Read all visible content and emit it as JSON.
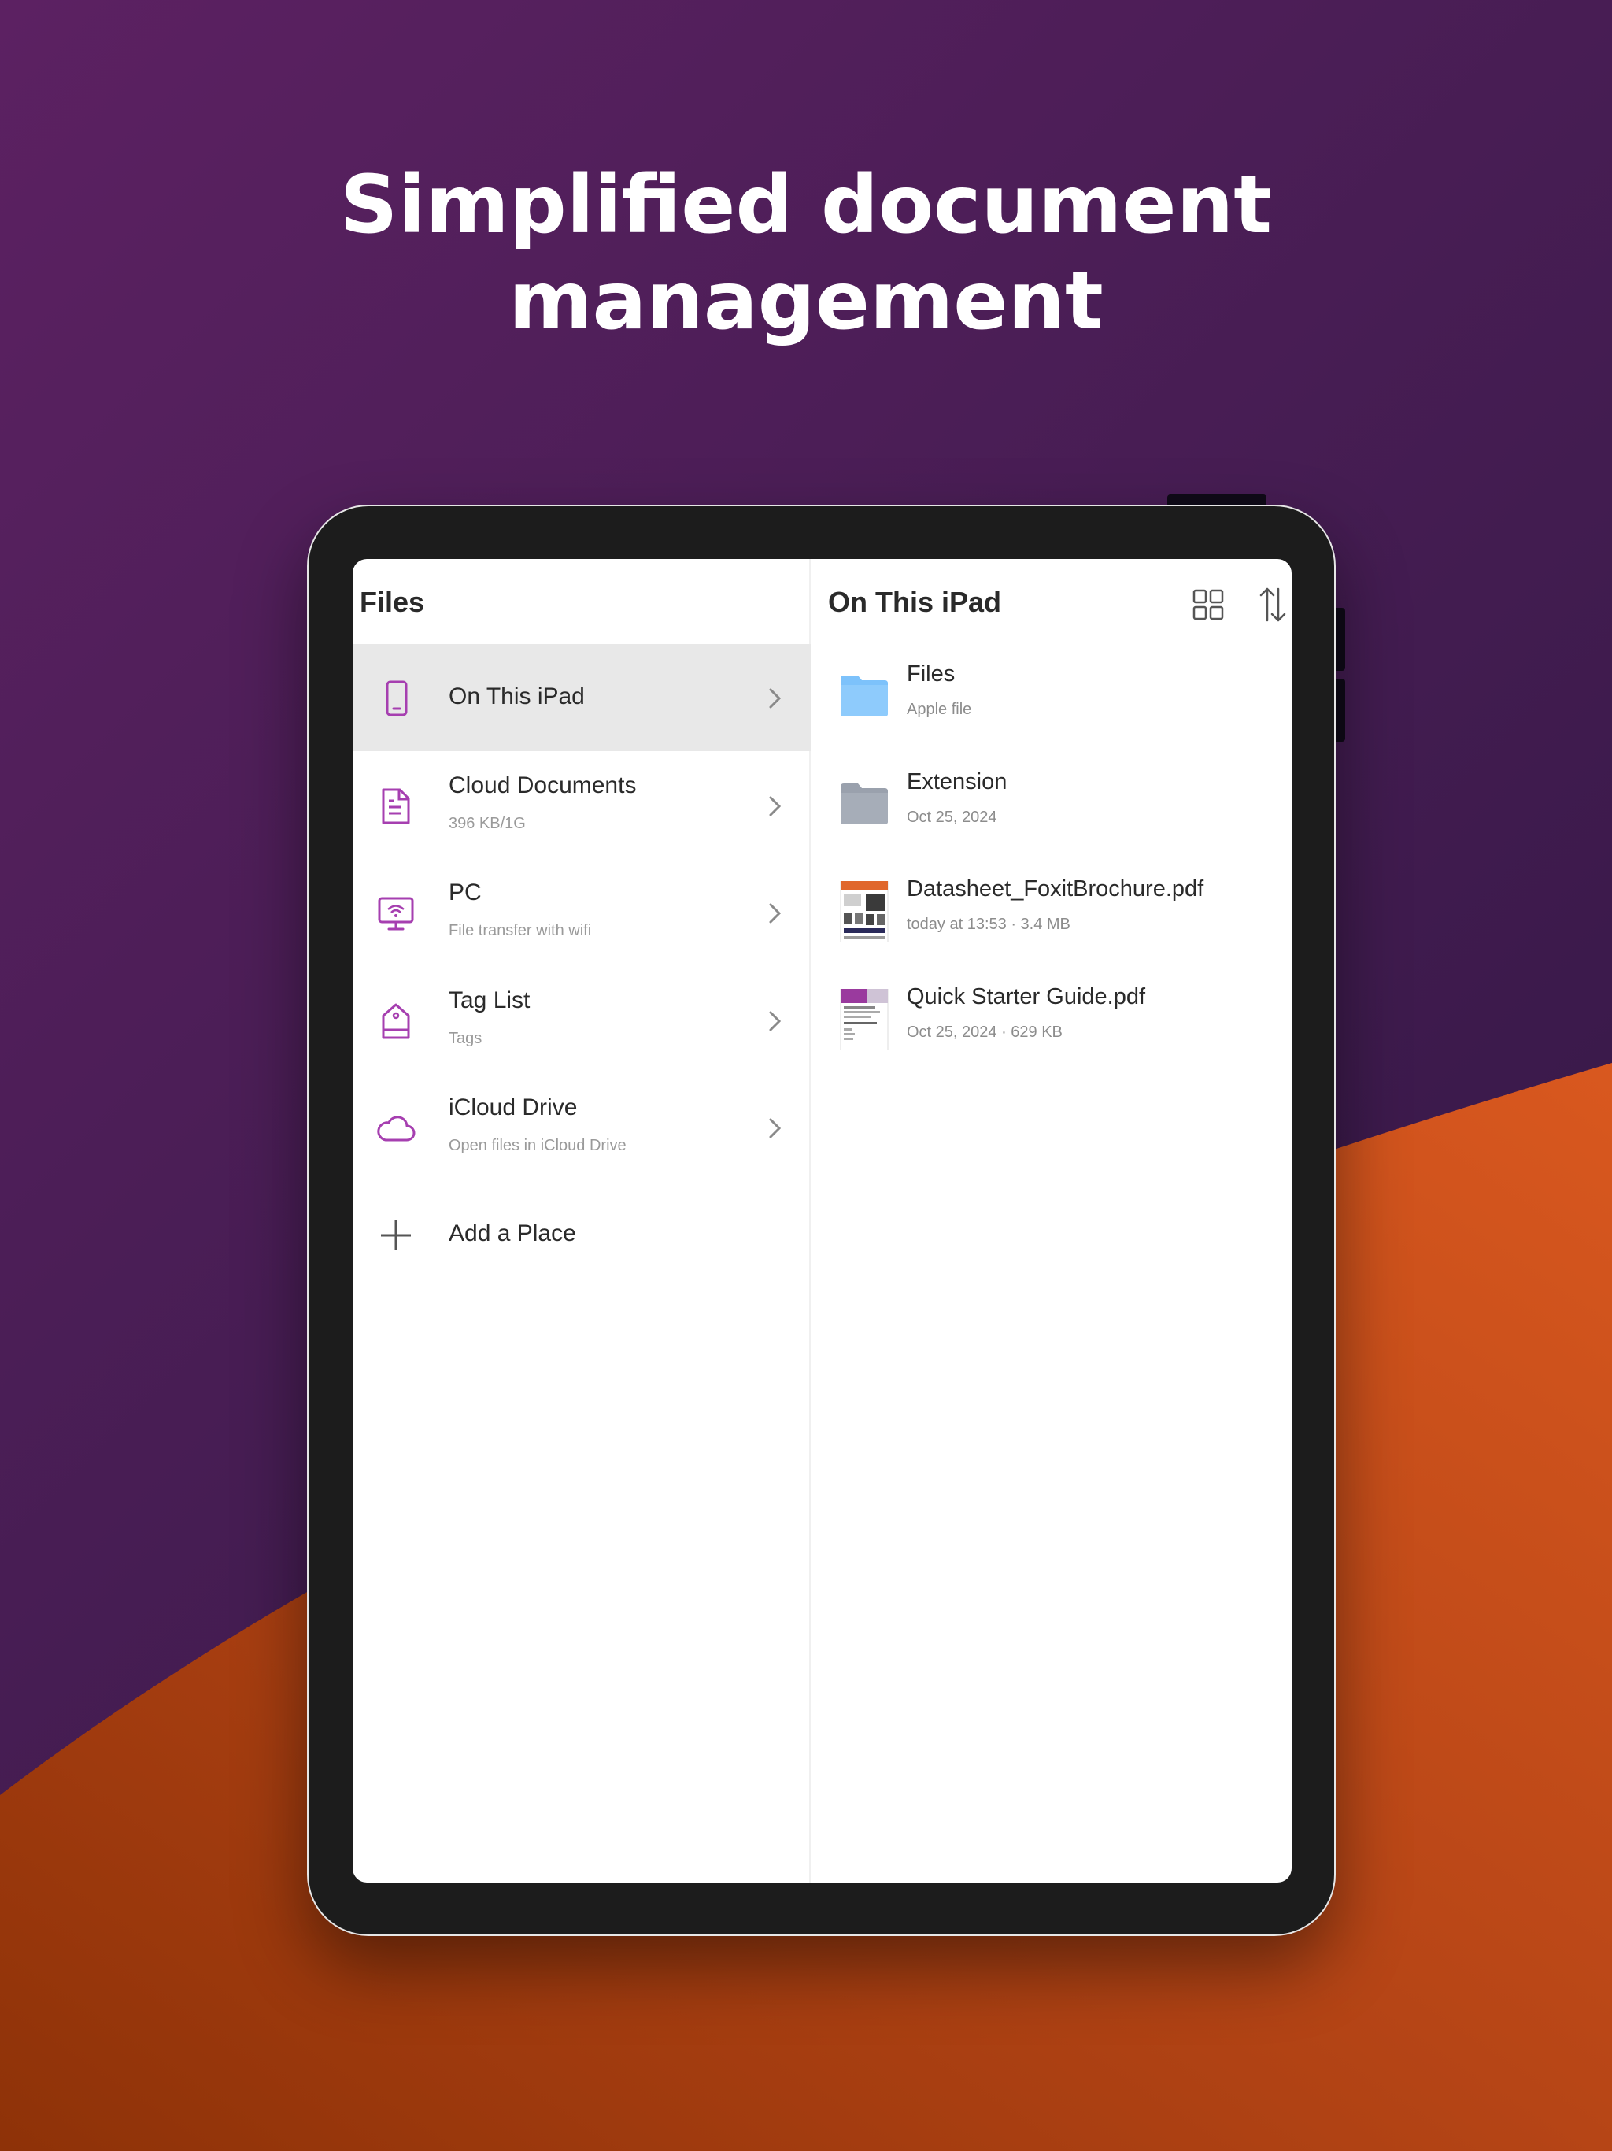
{
  "headline": {
    "line1": "Simplified document",
    "line2": "management"
  },
  "colors": {
    "accent": "#a63fb0",
    "folder_blue": "#7dc2fb",
    "folder_gray": "#a6adb8",
    "orange": "#c9511c"
  },
  "sidebar": {
    "title": "Files",
    "items": [
      {
        "label": "On This iPad",
        "sub": "",
        "icon": "ipad-icon",
        "active": true
      },
      {
        "label": "Cloud Documents",
        "sub": "396 KB/1G",
        "icon": "document-icon"
      },
      {
        "label": "PC",
        "sub": "File transfer with wifi",
        "icon": "monitor-wifi-icon"
      },
      {
        "label": "Tag List",
        "sub": "Tags",
        "icon": "tag-icon"
      },
      {
        "label": "iCloud Drive",
        "sub": "Open files in iCloud Drive",
        "icon": "cloud-icon"
      },
      {
        "label": "Add a Place",
        "sub": "",
        "icon": "plus-icon"
      }
    ]
  },
  "main": {
    "title": "On This iPad",
    "files": [
      {
        "name": "Files",
        "meta": "Apple file",
        "icon": "folder-icon-blue"
      },
      {
        "name": "Extension",
        "meta": "Oct 25, 2024",
        "icon": "folder-icon-gray"
      },
      {
        "name": "Datasheet_FoxitBrochure.pdf",
        "meta": "today at 13:53 · 3.4 MB",
        "icon": "pdf-thumbnail"
      },
      {
        "name": "Quick Starter Guide.pdf",
        "meta": "Oct 25, 2024 · 629 KB",
        "icon": "pdf-thumbnail"
      }
    ]
  }
}
